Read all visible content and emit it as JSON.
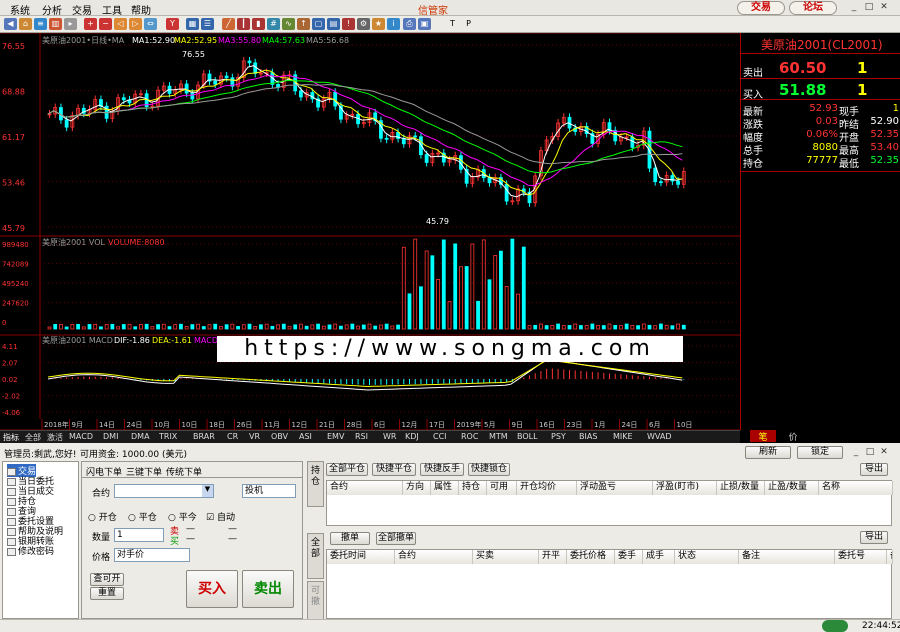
{
  "menu": {
    "items": [
      "系统",
      "分析",
      "交易",
      "工具",
      "帮助"
    ],
    "title": "信管家",
    "trade_btn": "交易",
    "forum_btn": "论坛"
  },
  "toolbar": {
    "extra": [
      "T",
      "P"
    ]
  },
  "price_chart": {
    "header": "美原油2001•日线•MA",
    "ma1": "MA1:52.90",
    "ma2": "MA2:52.95",
    "ma3": "MA3:55.80",
    "ma4": "MA4:57.63",
    "ma5": "MA5:56.68",
    "y_ticks": [
      "76.55",
      "68.88",
      "61.17",
      "53.46",
      "45.79"
    ],
    "high_label": "76.55",
    "low_label": "45.79",
    "colors": {
      "up": "#ff3333",
      "down": "#00ffff",
      "ma1": "#ffffff",
      "ma2": "#ffff00",
      "ma3": "#ff00ff",
      "ma4": "#00ff00",
      "ma5": "#999999"
    }
  },
  "vol_chart": {
    "header": "美原油2001 VOL",
    "vol_label": "VOLUME:8080",
    "y_ticks": [
      "989480",
      "742089",
      "495240",
      "247620",
      "0"
    ]
  },
  "macd_chart": {
    "header": "美原油2001 MACD",
    "dif": "DIF:-1.86",
    "dea": "DEA:-1.61",
    "macd": "MACD:-0.51",
    "y_ticks": [
      "4.11",
      "2.07",
      "0.02",
      "-2.02",
      "-4.06"
    ]
  },
  "x_ticks": [
    "2018年",
    "9月",
    "14日",
    "24日",
    "10月",
    "10日",
    "18日",
    "26日",
    "11月",
    "12日",
    "21日",
    "28日",
    "6日",
    "12月",
    "17日",
    "2019年",
    "5月",
    "9日",
    "16日",
    "23日",
    "1月",
    "24日",
    "6月",
    "10日"
  ],
  "watermark": "https://www.songma.com",
  "quote": {
    "contract": "美原油2001(CL2001)",
    "sell_label": "卖出",
    "sell_price": "60.50",
    "sell_qty": "1",
    "buy_label": "买入",
    "buy_price": "51.88",
    "buy_qty": "1",
    "rows": [
      {
        "l1": "最新",
        "v1": "52.93",
        "l2": "现手",
        "v2": "1"
      },
      {
        "l1": "涨跌",
        "v1": "0.03",
        "l2": "昨结",
        "v2": "52.90"
      },
      {
        "l1": "幅度",
        "v1": "0.06%",
        "l2": "开盘",
        "v2": "52.35"
      },
      {
        "l1": "总手",
        "v1": "8080",
        "l2": "最高",
        "v2": "53.40"
      },
      {
        "l1": "持仓",
        "v1": "77777",
        "l2": "最低",
        "v2": "52.35"
      }
    ],
    "tabs": [
      "笔",
      "价"
    ]
  },
  "indicator_tabs": [
    "指标",
    "全部",
    "激活",
    "MACD",
    "DMI",
    "DMA",
    "TRIX",
    "BRAR",
    "CR",
    "VR",
    "OBV",
    "ASI",
    "EMV",
    "RSI",
    "WR",
    "KDJ",
    "CCI",
    "ROC",
    "MTM",
    "BOLL",
    "PSY",
    "BIAS",
    "MIKE",
    "WVAD"
  ],
  "bottom": {
    "admin": "管理员:剩武,您好!",
    "funds": "可用资金: 1000.00 (美元)",
    "refresh": "刷新",
    "lock": "锁定",
    "tree": [
      "交易",
      "当日委托",
      "当日成交",
      "持仓",
      "查询",
      "委托设置",
      "帮助及说明",
      "银期转账",
      "修改密码"
    ],
    "order_tabs": [
      "闪电下单",
      "三键下单",
      "传统下单"
    ],
    "contract_label": "合约",
    "type_value": "投机",
    "radios": [
      "开仓",
      "平仓",
      "平今"
    ],
    "auto_label": "自动",
    "qty_label": "数量",
    "qty_value": "1",
    "sell_s": "卖",
    "buy_s": "买",
    "dash": "—",
    "price_label": "价格",
    "price_value": "对手价",
    "query_btn": "查可开",
    "reset_btn": "重置",
    "buy_btn": "买入",
    "sell_btn": "卖出",
    "vtabs": [
      "持仓",
      "全部",
      "可撤"
    ],
    "pos_btns": [
      "全部平仓",
      "快捷平仓",
      "快捷反手",
      "快捷锁仓"
    ],
    "export": "导出",
    "pos_cols": [
      "合约",
      "方向",
      "属性",
      "持仓",
      "可用",
      "开仓均价",
      "浮动盈亏",
      "浮盈(盯市)",
      "止损/数量",
      "止盈/数量",
      "名称"
    ],
    "ord_btns": [
      "撤单",
      "全部撤单"
    ],
    "ord_cols": [
      "委托时间",
      "合约",
      "买卖",
      "开平",
      "委托价格",
      "委手",
      "成手",
      "状态",
      "备注",
      "委托号",
      "备"
    ]
  },
  "status": {
    "time": "22:44:52"
  }
}
